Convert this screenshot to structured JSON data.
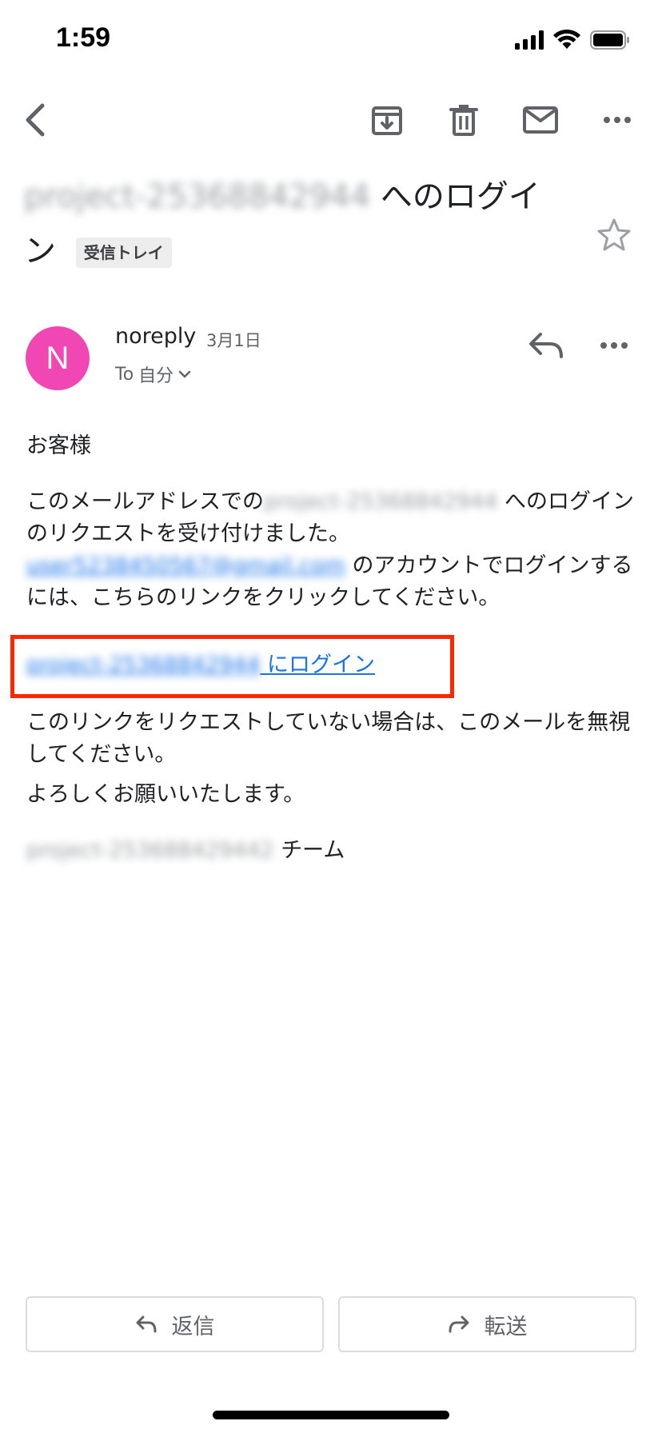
{
  "status_bar": {
    "time": "1:59"
  },
  "subject": {
    "blurred_project": "project-25368842944",
    "title_suffix": "へのログイ",
    "title_wrap": "ン",
    "label": "受信トレイ"
  },
  "sender": {
    "initial": "N",
    "name": "noreply",
    "date": "3月1日",
    "to_prefix": "To",
    "to_value": "自分"
  },
  "body": {
    "greeting": "お客様",
    "p1_before": "このメールアドレスでの",
    "p1_blurred_project": "project-25368842944",
    "p1_mid": "へのログインのリクエストを受け付けました。",
    "p1_blurred_email": "user5238450567@gmail.com",
    "p1_after": "のアカウントでログインするには、こちらのリンクをクリックしてください。",
    "login_link_blurred": "project-25368842944",
    "login_link_suffix": " にログイン",
    "p2": "このリンクをリクエストしていない場合は、このメールを無視してください。",
    "closing": "よろしくお願いいたします。",
    "team_blurred": "project-253688429442",
    "team_suffix": "チーム"
  },
  "actions": {
    "reply_label": "返信",
    "forward_label": "転送"
  },
  "colors": {
    "avatar": "#f147b4",
    "link": "#1a73e8",
    "highlight": "#ff2600"
  },
  "icons": [
    "back-icon",
    "archive-icon",
    "delete-icon",
    "mail-icon",
    "more-icon",
    "star-icon",
    "reply-icon",
    "forward-icon"
  ]
}
